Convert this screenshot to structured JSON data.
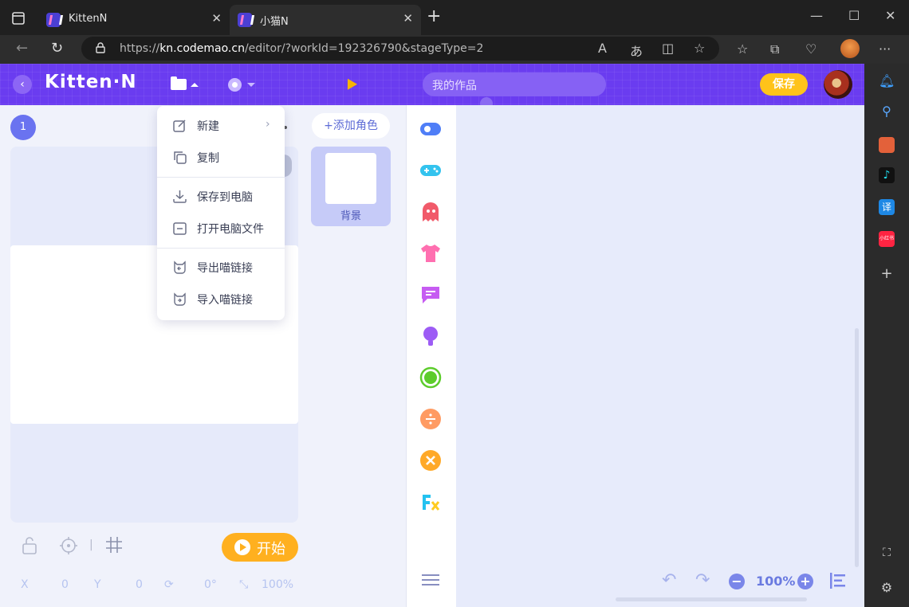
{
  "browser": {
    "tabs": [
      {
        "title": "KittenN",
        "active": false
      },
      {
        "title": "小猫N",
        "active": true
      }
    ],
    "url_prefix": "https://",
    "url_domain": "kn.codemao.cn",
    "url_path": "/editor/?workId=192326790&stageType=2"
  },
  "app": {
    "logo": "Kitten·N",
    "search_placeholder": "我的作品",
    "save_label": "保存",
    "accent": "#6a3cf0",
    "save_color": "#ffc31a"
  },
  "file_menu": {
    "items": [
      {
        "label": "新建",
        "has_submenu": true
      },
      {
        "label": "复制"
      },
      {
        "label": "保存到电脑"
      },
      {
        "label": "打开电脑文件"
      },
      {
        "label": "导出喵链接"
      },
      {
        "label": "导入喵链接"
      }
    ]
  },
  "stage": {
    "scene_number": "1",
    "start_label": "开始",
    "x_label": "X",
    "x_value": "0",
    "y_label": "Y",
    "y_value": "0",
    "rotation": "0°",
    "scale": "100%"
  },
  "sprites": {
    "add_label": "添加角色",
    "background_label": "背景"
  },
  "workspace": {
    "zoom": "100%"
  }
}
